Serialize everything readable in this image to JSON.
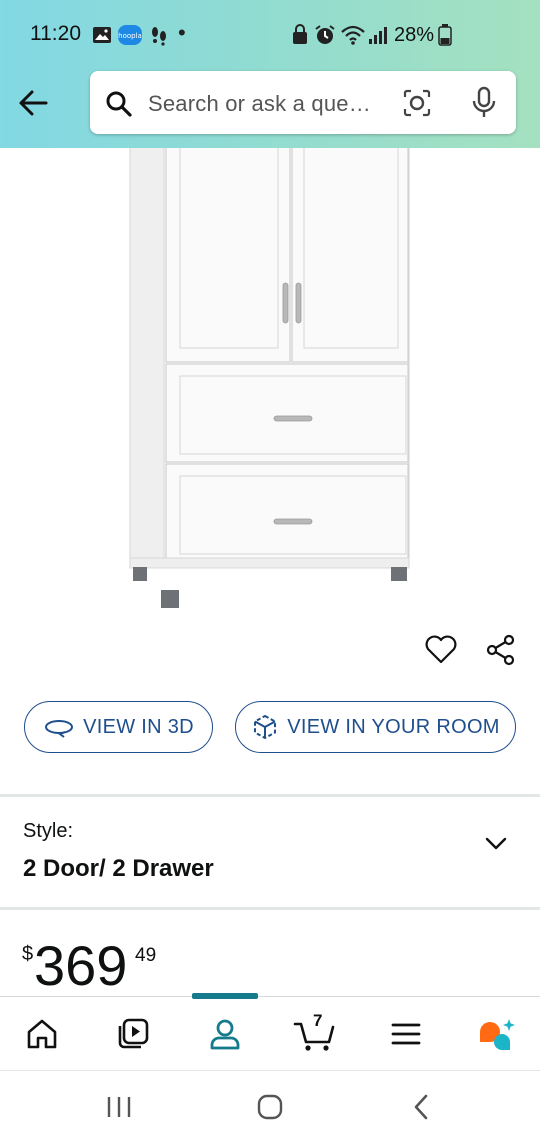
{
  "status_bar": {
    "time": "11:20",
    "battery": "28%",
    "dot": "•"
  },
  "header": {
    "search_placeholder": "Search or ask a que…"
  },
  "actions": {
    "view_3d": "VIEW IN 3D",
    "view_room": "VIEW IN YOUR ROOM"
  },
  "style": {
    "label": "Style:",
    "value": "2 Door/ 2 Drawer"
  },
  "price": {
    "symbol": "$",
    "whole": "369",
    "fraction": "49"
  },
  "bottom_nav": {
    "cart_count": "7",
    "active_tab": "account"
  },
  "colors": {
    "accent": "#157b8c",
    "link": "#1f4e8c",
    "header_gradient_start": "#82d8e3",
    "header_gradient_end": "#a5e1c0"
  }
}
